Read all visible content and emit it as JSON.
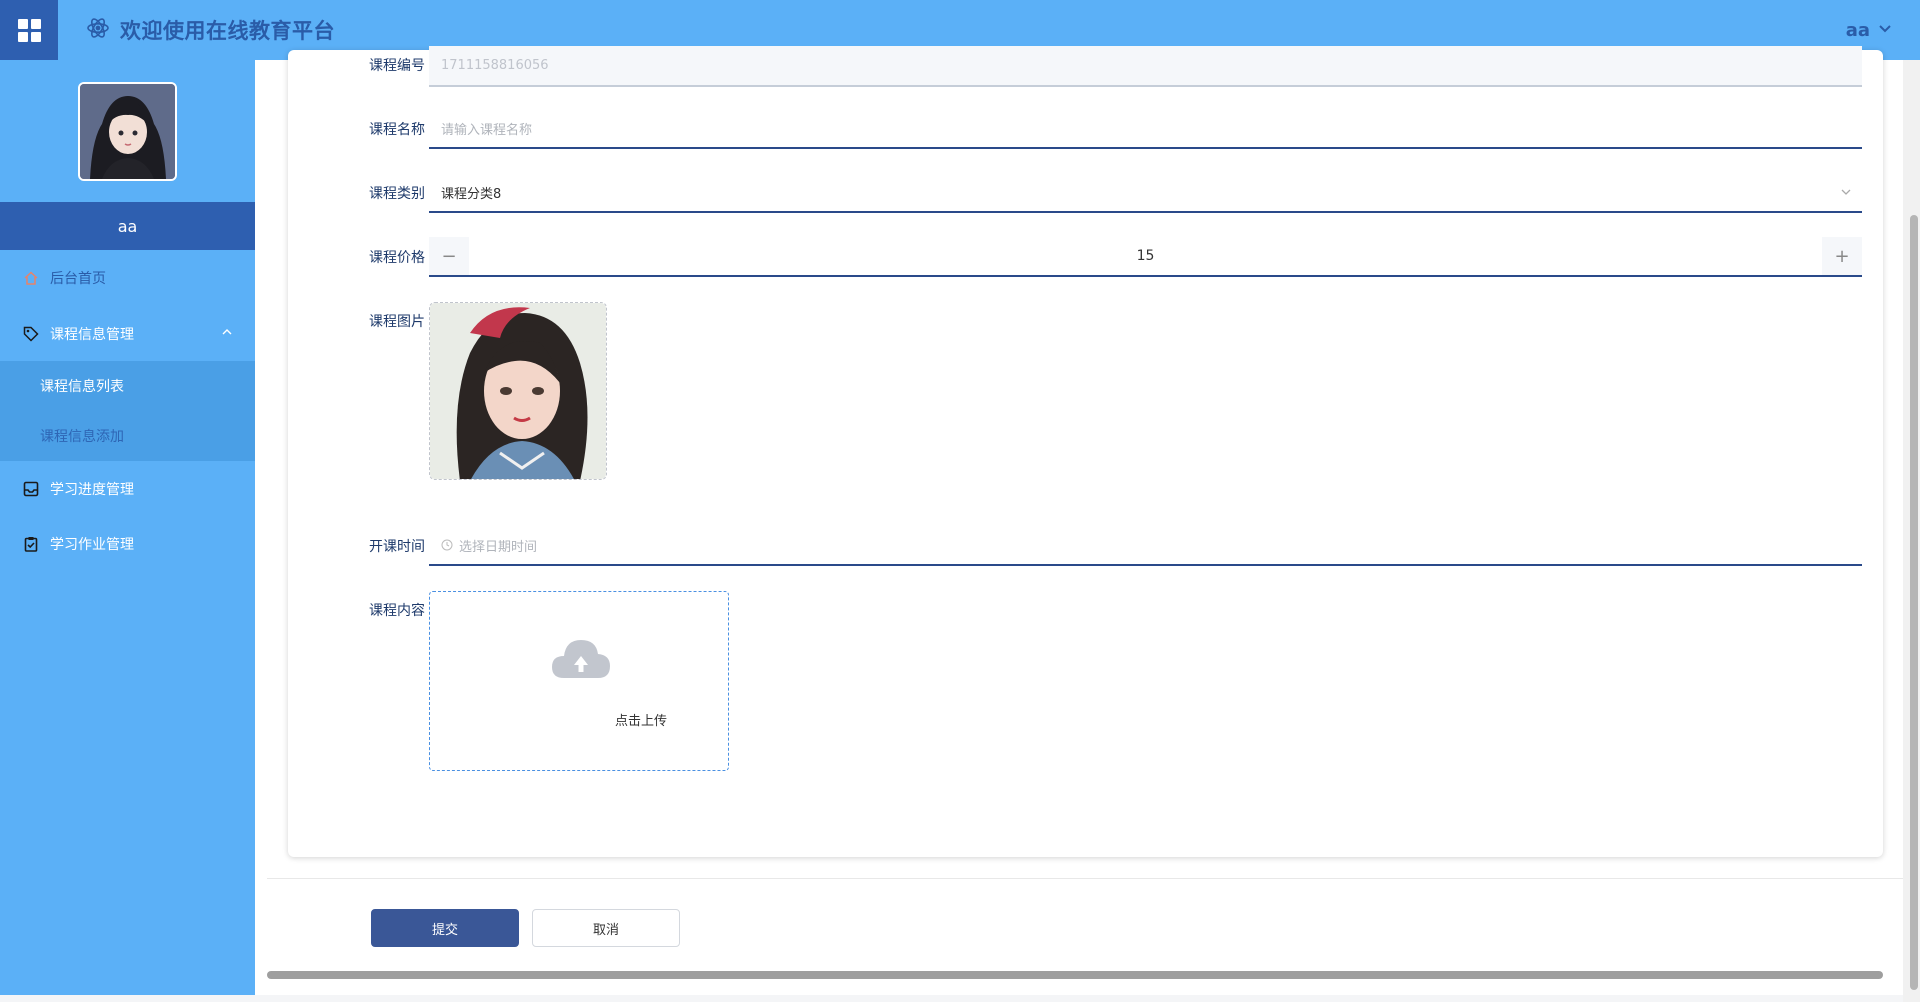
{
  "header": {
    "title": "欢迎使用在线教育平台",
    "user": "aa"
  },
  "sidebar": {
    "username": "aa",
    "home_label": "后台首页",
    "menus": [
      {
        "label": "课程信息管理",
        "children": [
          "课程信息列表",
          "课程信息添加"
        ]
      },
      {
        "label": "学习进度管理"
      },
      {
        "label": "学习作业管理"
      }
    ]
  },
  "form": {
    "fields": [
      {
        "label": "课程编号",
        "value": "1711158816056"
      },
      {
        "label": "课程名称",
        "placeholder": "请输入课程名称"
      },
      {
        "label": "课程类别",
        "value": "课程分类8"
      },
      {
        "label": "课程价格",
        "value": "15"
      },
      {
        "label": "课程图片"
      },
      {
        "label": "开课时间",
        "placeholder": "选择日期时间"
      },
      {
        "label": "课程内容",
        "upload_text": "点击上传"
      }
    ],
    "submit_label": "提交",
    "cancel_label": "取消"
  },
  "colors": {
    "header_bg": "#5bb0f7",
    "accent_dark": "#2e5fb0",
    "submit_bg": "#3a5797"
  }
}
